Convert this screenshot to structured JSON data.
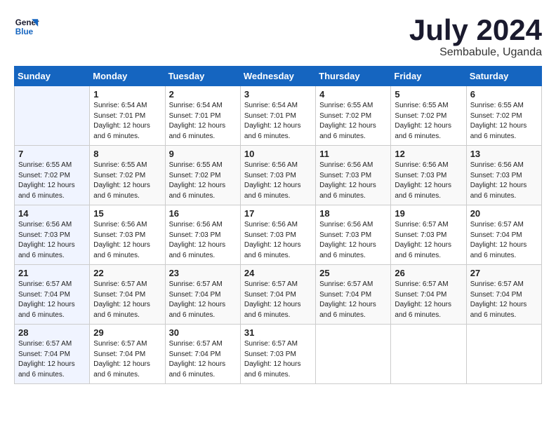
{
  "logo": {
    "line1": "General",
    "line2": "Blue"
  },
  "title": {
    "month_year": "July 2024",
    "location": "Sembabule, Uganda"
  },
  "days_of_week": [
    "Sunday",
    "Monday",
    "Tuesday",
    "Wednesday",
    "Thursday",
    "Friday",
    "Saturday"
  ],
  "weeks": [
    [
      {
        "day": "",
        "sunrise": "",
        "sunset": "",
        "daylight": ""
      },
      {
        "day": "1",
        "sunrise": "Sunrise: 6:54 AM",
        "sunset": "Sunset: 7:01 PM",
        "daylight": "Daylight: 12 hours and 6 minutes."
      },
      {
        "day": "2",
        "sunrise": "Sunrise: 6:54 AM",
        "sunset": "Sunset: 7:01 PM",
        "daylight": "Daylight: 12 hours and 6 minutes."
      },
      {
        "day": "3",
        "sunrise": "Sunrise: 6:54 AM",
        "sunset": "Sunset: 7:01 PM",
        "daylight": "Daylight: 12 hours and 6 minutes."
      },
      {
        "day": "4",
        "sunrise": "Sunrise: 6:55 AM",
        "sunset": "Sunset: 7:02 PM",
        "daylight": "Daylight: 12 hours and 6 minutes."
      },
      {
        "day": "5",
        "sunrise": "Sunrise: 6:55 AM",
        "sunset": "Sunset: 7:02 PM",
        "daylight": "Daylight: 12 hours and 6 minutes."
      },
      {
        "day": "6",
        "sunrise": "Sunrise: 6:55 AM",
        "sunset": "Sunset: 7:02 PM",
        "daylight": "Daylight: 12 hours and 6 minutes."
      }
    ],
    [
      {
        "day": "7",
        "sunrise": "Sunrise: 6:55 AM",
        "sunset": "Sunset: 7:02 PM",
        "daylight": "Daylight: 12 hours and 6 minutes."
      },
      {
        "day": "8",
        "sunrise": "Sunrise: 6:55 AM",
        "sunset": "Sunset: 7:02 PM",
        "daylight": "Daylight: 12 hours and 6 minutes."
      },
      {
        "day": "9",
        "sunrise": "Sunrise: 6:55 AM",
        "sunset": "Sunset: 7:02 PM",
        "daylight": "Daylight: 12 hours and 6 minutes."
      },
      {
        "day": "10",
        "sunrise": "Sunrise: 6:56 AM",
        "sunset": "Sunset: 7:03 PM",
        "daylight": "Daylight: 12 hours and 6 minutes."
      },
      {
        "day": "11",
        "sunrise": "Sunrise: 6:56 AM",
        "sunset": "Sunset: 7:03 PM",
        "daylight": "Daylight: 12 hours and 6 minutes."
      },
      {
        "day": "12",
        "sunrise": "Sunrise: 6:56 AM",
        "sunset": "Sunset: 7:03 PM",
        "daylight": "Daylight: 12 hours and 6 minutes."
      },
      {
        "day": "13",
        "sunrise": "Sunrise: 6:56 AM",
        "sunset": "Sunset: 7:03 PM",
        "daylight": "Daylight: 12 hours and 6 minutes."
      }
    ],
    [
      {
        "day": "14",
        "sunrise": "Sunrise: 6:56 AM",
        "sunset": "Sunset: 7:03 PM",
        "daylight": "Daylight: 12 hours and 6 minutes."
      },
      {
        "day": "15",
        "sunrise": "Sunrise: 6:56 AM",
        "sunset": "Sunset: 7:03 PM",
        "daylight": "Daylight: 12 hours and 6 minutes."
      },
      {
        "day": "16",
        "sunrise": "Sunrise: 6:56 AM",
        "sunset": "Sunset: 7:03 PM",
        "daylight": "Daylight: 12 hours and 6 minutes."
      },
      {
        "day": "17",
        "sunrise": "Sunrise: 6:56 AM",
        "sunset": "Sunset: 7:03 PM",
        "daylight": "Daylight: 12 hours and 6 minutes."
      },
      {
        "day": "18",
        "sunrise": "Sunrise: 6:56 AM",
        "sunset": "Sunset: 7:03 PM",
        "daylight": "Daylight: 12 hours and 6 minutes."
      },
      {
        "day": "19",
        "sunrise": "Sunrise: 6:57 AM",
        "sunset": "Sunset: 7:03 PM",
        "daylight": "Daylight: 12 hours and 6 minutes."
      },
      {
        "day": "20",
        "sunrise": "Sunrise: 6:57 AM",
        "sunset": "Sunset: 7:04 PM",
        "daylight": "Daylight: 12 hours and 6 minutes."
      }
    ],
    [
      {
        "day": "21",
        "sunrise": "Sunrise: 6:57 AM",
        "sunset": "Sunset: 7:04 PM",
        "daylight": "Daylight: 12 hours and 6 minutes."
      },
      {
        "day": "22",
        "sunrise": "Sunrise: 6:57 AM",
        "sunset": "Sunset: 7:04 PM",
        "daylight": "Daylight: 12 hours and 6 minutes."
      },
      {
        "day": "23",
        "sunrise": "Sunrise: 6:57 AM",
        "sunset": "Sunset: 7:04 PM",
        "daylight": "Daylight: 12 hours and 6 minutes."
      },
      {
        "day": "24",
        "sunrise": "Sunrise: 6:57 AM",
        "sunset": "Sunset: 7:04 PM",
        "daylight": "Daylight: 12 hours and 6 minutes."
      },
      {
        "day": "25",
        "sunrise": "Sunrise: 6:57 AM",
        "sunset": "Sunset: 7:04 PM",
        "daylight": "Daylight: 12 hours and 6 minutes."
      },
      {
        "day": "26",
        "sunrise": "Sunrise: 6:57 AM",
        "sunset": "Sunset: 7:04 PM",
        "daylight": "Daylight: 12 hours and 6 minutes."
      },
      {
        "day": "27",
        "sunrise": "Sunrise: 6:57 AM",
        "sunset": "Sunset: 7:04 PM",
        "daylight": "Daylight: 12 hours and 6 minutes."
      }
    ],
    [
      {
        "day": "28",
        "sunrise": "Sunrise: 6:57 AM",
        "sunset": "Sunset: 7:04 PM",
        "daylight": "Daylight: 12 hours and 6 minutes."
      },
      {
        "day": "29",
        "sunrise": "Sunrise: 6:57 AM",
        "sunset": "Sunset: 7:04 PM",
        "daylight": "Daylight: 12 hours and 6 minutes."
      },
      {
        "day": "30",
        "sunrise": "Sunrise: 6:57 AM",
        "sunset": "Sunset: 7:04 PM",
        "daylight": "Daylight: 12 hours and 6 minutes."
      },
      {
        "day": "31",
        "sunrise": "Sunrise: 6:57 AM",
        "sunset": "Sunset: 7:03 PM",
        "daylight": "Daylight: 12 hours and 6 minutes."
      },
      {
        "day": "",
        "sunrise": "",
        "sunset": "",
        "daylight": ""
      },
      {
        "day": "",
        "sunrise": "",
        "sunset": "",
        "daylight": ""
      },
      {
        "day": "",
        "sunrise": "",
        "sunset": "",
        "daylight": ""
      }
    ]
  ]
}
